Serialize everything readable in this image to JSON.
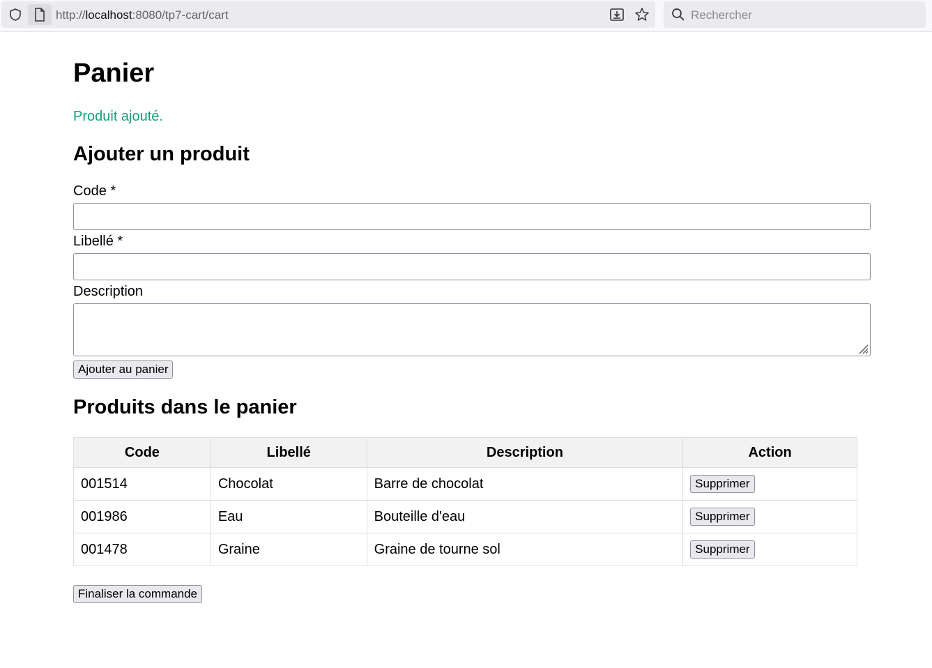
{
  "browser": {
    "url_prefix": "http://",
    "url_host": "localhost",
    "url_rest": ":8080/tp7-cart/cart",
    "search_placeholder": "Rechercher"
  },
  "page": {
    "title": "Panier",
    "success_message": "Produit ajouté.",
    "success_color": "#13a07c"
  },
  "form": {
    "heading": "Ajouter un produit",
    "code_label": "Code *",
    "code_value": "",
    "libelle_label": "Libellé *",
    "libelle_value": "",
    "description_label": "Description",
    "description_value": "",
    "submit_label": "Ajouter au panier"
  },
  "cart": {
    "heading": "Produits dans le panier",
    "columns": [
      "Code",
      "Libellé",
      "Description",
      "Action"
    ],
    "rows": [
      {
        "code": "001514",
        "libelle": "Chocolat",
        "description": "Barre de chocolat",
        "action": "Supprimer"
      },
      {
        "code": "001986",
        "libelle": "Eau",
        "description": "Bouteille d'eau",
        "action": "Supprimer"
      },
      {
        "code": "001478",
        "libelle": "Graine",
        "description": "Graine de tourne sol",
        "action": "Supprimer"
      }
    ],
    "finalize_label": "Finaliser la commande"
  }
}
